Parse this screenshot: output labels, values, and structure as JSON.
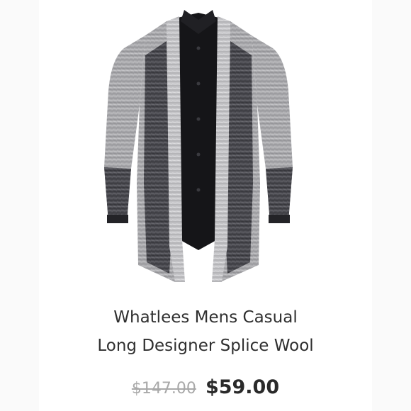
{
  "product": {
    "image_icon": "cardigan-image",
    "title_line1": "Whatlees Mens Casual",
    "title_line2": "Long Designer Splice Wool",
    "original_price": "$147.00",
    "sale_price": "$59.00"
  },
  "colors": {
    "title_text": "#2f2f2f",
    "original_price_text": "#a9a9a9",
    "sale_price_text": "#2a2a2a",
    "background": "#ffffff"
  }
}
